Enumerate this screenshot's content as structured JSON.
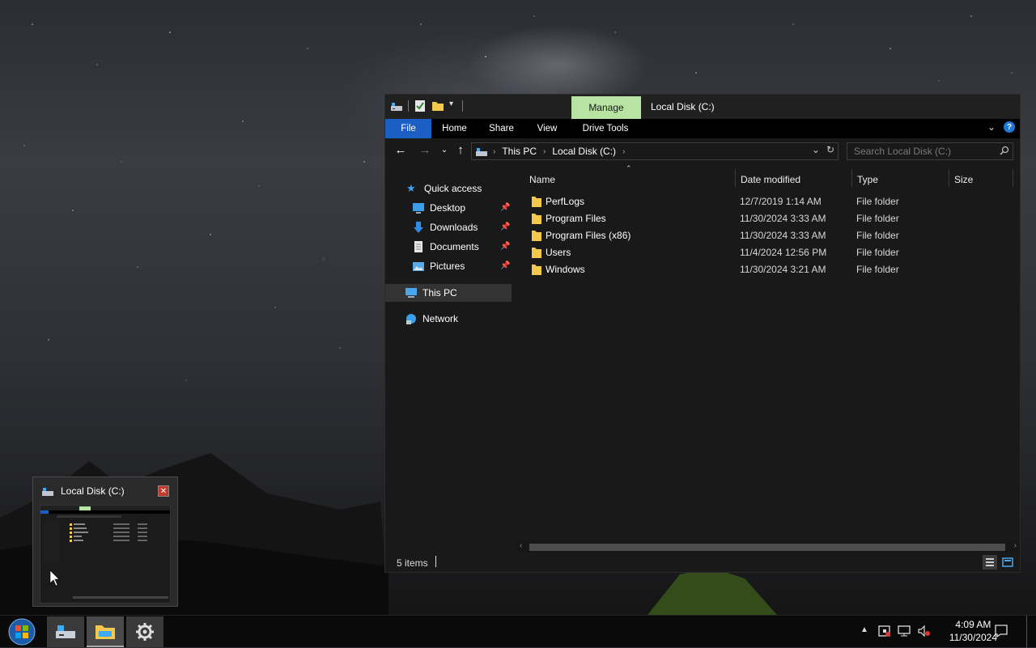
{
  "explorer": {
    "title": "Local Disk (C:)",
    "manage_tab": "Manage",
    "ribbon_tabs": [
      "File",
      "Home",
      "Share",
      "View",
      "Drive Tools"
    ],
    "address": {
      "crumbs": [
        "This PC",
        "Local Disk (C:)"
      ]
    },
    "search_placeholder": "Search Local Disk (C:)",
    "nav": {
      "quick_access": "Quick access",
      "desktop": "Desktop",
      "downloads": "Downloads",
      "documents": "Documents",
      "pictures": "Pictures",
      "this_pc": "This PC",
      "network": "Network"
    },
    "columns": {
      "name": "Name",
      "date": "Date modified",
      "type": "Type",
      "size": "Size"
    },
    "files": [
      {
        "name": "PerfLogs",
        "date": "12/7/2019 1:14 AM",
        "type": "File folder"
      },
      {
        "name": "Program Files",
        "date": "11/30/2024 3:33 AM",
        "type": "File folder"
      },
      {
        "name": "Program Files (x86)",
        "date": "11/30/2024 3:33 AM",
        "type": "File folder"
      },
      {
        "name": "Users",
        "date": "11/4/2024 12:56 PM",
        "type": "File folder"
      },
      {
        "name": "Windows",
        "date": "11/30/2024 3:21 AM",
        "type": "File folder"
      }
    ],
    "status": "5 items"
  },
  "thumbnail": {
    "title": "Local Disk (C:)"
  },
  "taskbar": {
    "time": "4:09 AM",
    "date": "11/30/2024"
  },
  "colors": {
    "accent": "#1b5fc4",
    "manage_tab": "#b7e4a2",
    "folder": "#f2c94c"
  }
}
